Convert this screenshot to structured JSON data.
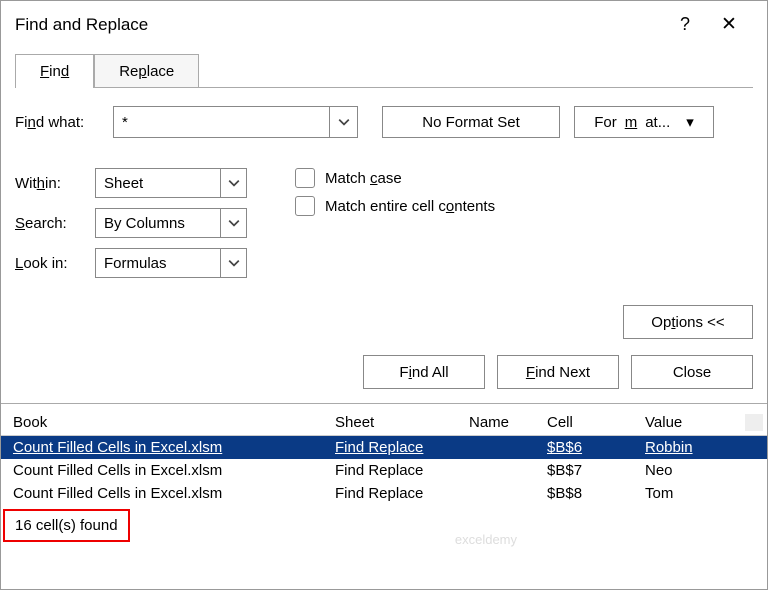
{
  "title": "Find and Replace",
  "tabs": {
    "find": "Find",
    "replace": "Replace"
  },
  "findwhat_label": "Find what:",
  "findwhat_value": "*",
  "noformat_label": "No Format Set",
  "format_label": "Format...",
  "within_label": "Within:",
  "within_value": "Sheet",
  "search_label": "Search:",
  "search_value": "By Columns",
  "lookin_label": "Look in:",
  "lookin_value": "Formulas",
  "matchcase_label": "Match case",
  "matchentire_label": "Match entire cell contents",
  "options_label": "Options <<",
  "findall_label": "Find All",
  "findnext_label": "Find Next",
  "close_label": "Close",
  "cols": {
    "book": "Book",
    "sheet": "Sheet",
    "name": "Name",
    "cell": "Cell",
    "value": "Value"
  },
  "rows": [
    {
      "book": "Count Filled Cells in Excel.xlsm",
      "sheet": "Find Replace",
      "name": "",
      "cell": "$B$6",
      "value": "Robbin"
    },
    {
      "book": "Count Filled Cells in Excel.xlsm",
      "sheet": "Find Replace",
      "name": "",
      "cell": "$B$7",
      "value": "Neo"
    },
    {
      "book": "Count Filled Cells in Excel.xlsm",
      "sheet": "Find Replace",
      "name": "",
      "cell": "$B$8",
      "value": "Tom"
    }
  ],
  "status": "16 cell(s) found",
  "watermark": "exceldemy"
}
